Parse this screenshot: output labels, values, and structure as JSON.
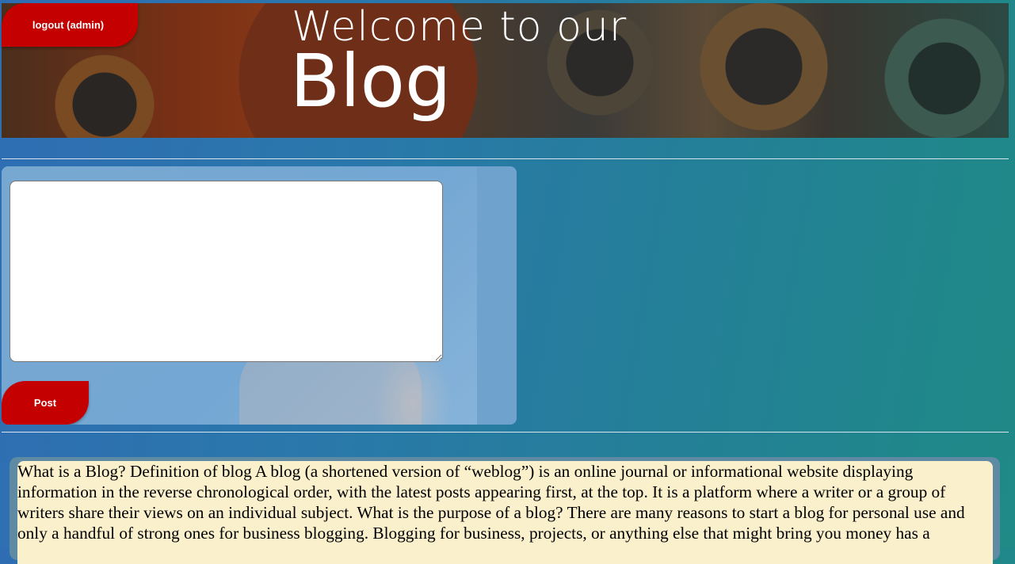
{
  "header": {
    "logout_label": "logout (admin)",
    "title_line1": "Welcome to our",
    "title_line2": "Blog"
  },
  "composer": {
    "textarea_value": "",
    "post_label": "Post"
  },
  "posts": [
    {
      "text": "What is a Blog? Definition of blog A blog (a shortened version of “weblog”) is an online journal or informational website displaying information in the reverse chronological order, with the latest posts appearing first, at the top. It is a platform where a writer or a group of writers share their views on an individual subject. What is the purpose of a blog? There are many reasons to start a blog for personal use and only a handful of strong ones for business blogging. Blogging for business, projects, or anything else that might bring you money has a"
    }
  ],
  "colors": {
    "button_red": "#c40000",
    "post_background": "#faf0cc"
  }
}
